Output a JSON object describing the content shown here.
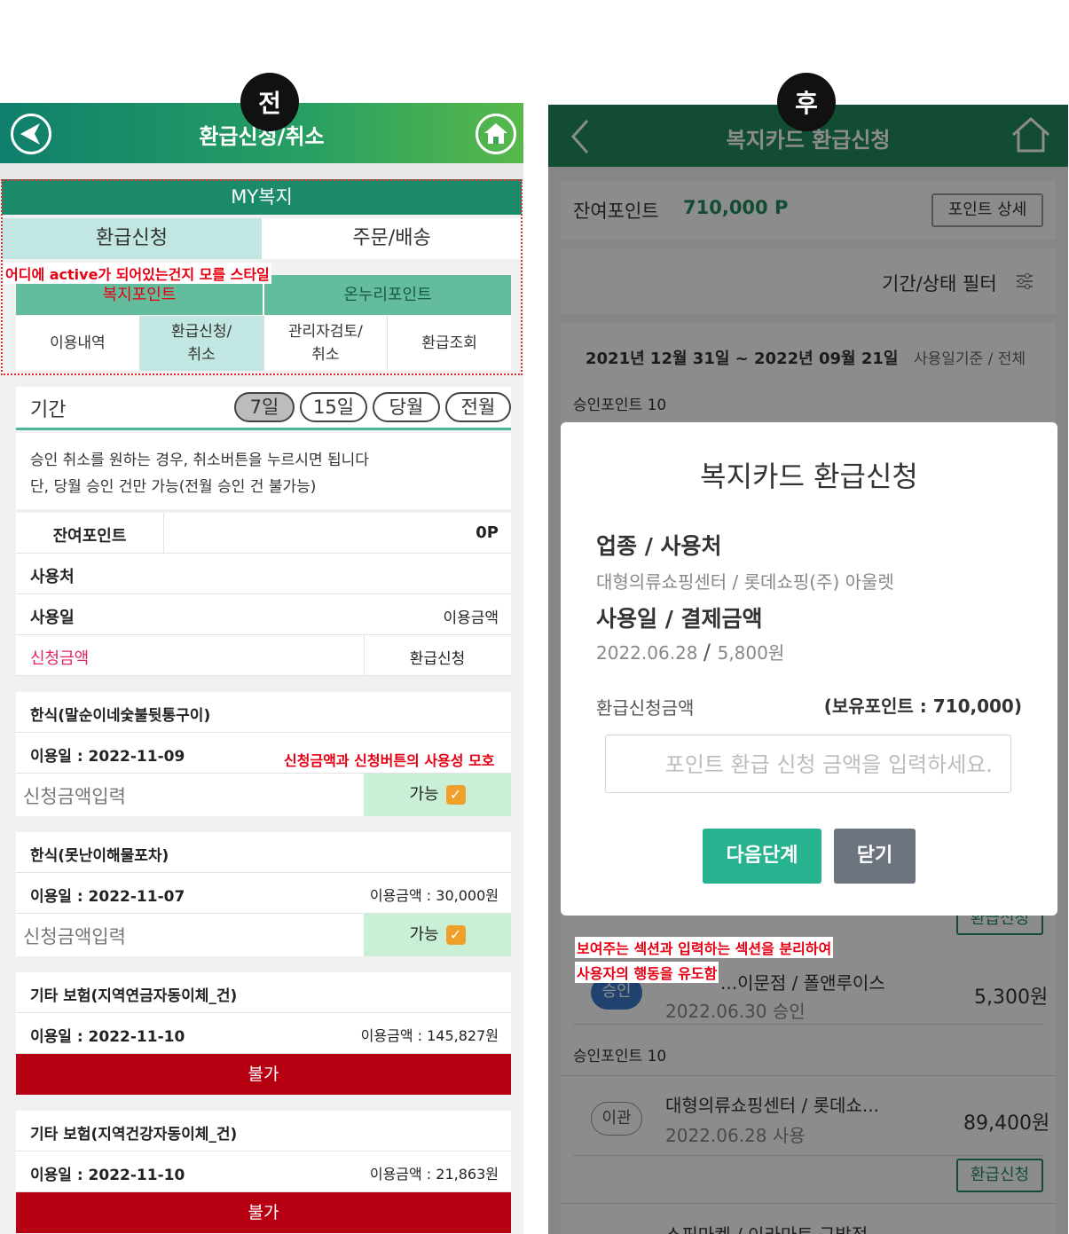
{
  "badges": {
    "before": "전",
    "after": "후"
  },
  "left": {
    "header_title": "환급신청/취소",
    "myw": "MY복지",
    "tabs1": [
      "환급신청",
      "주문/배송"
    ],
    "note_active": "어디에 active가 되어있는건지 모를 스타일",
    "tabs2": [
      "복지포인트",
      "온누리포인트"
    ],
    "tabs3": [
      "이용내역",
      "환급신청/\n취소",
      "관리자검토/\n취소",
      "환급조회"
    ],
    "period": {
      "label": "기간",
      "pills": [
        "7일",
        "15일",
        "당월",
        "전월"
      ]
    },
    "info_lines": [
      "승인 취소를 원하는 경우, 취소버튼을 누르시면 됩니다",
      "단, 당월 승인 건만 가능(전월 승인 건 불가능)"
    ],
    "summary": {
      "balance_label": "잔여포인트",
      "balance_value": "0P",
      "usage_place": "사용처",
      "usage_date": "사용일",
      "usage_amount": "이용금액",
      "request_amount": "신청금액",
      "request_btn": "환급신청"
    },
    "note_usability": "신청금액과 신청버튼의 사용성 모호",
    "items": [
      {
        "title": "한식(말순이네숯불뒷통구이)",
        "date": "이용일 : 2022-11-09",
        "amount": "",
        "input": "신청금액입력",
        "status": "가능"
      },
      {
        "title": "한식(못난이해물포차)",
        "date": "이용일 : 2022-11-07",
        "amount": "이용금액 : 30,000원",
        "input": "신청금액입력",
        "status": "가능"
      },
      {
        "title": "기타 보험(지역연금자동이체_건)",
        "date": "이용일 : 2022-11-10",
        "amount": "이용금액 : 145,827원",
        "status": "불가"
      },
      {
        "title": "기타 보험(지역건강자동이체_건)",
        "date": "이용일 : 2022-11-10",
        "amount": "이용금액 : 21,863원",
        "status": "불가"
      }
    ]
  },
  "right": {
    "header_title": "복지카드 환급신청",
    "balance_label": "잔여포인트",
    "balance_value": "710,000 P",
    "detail_btn": "포인트 상세",
    "filter": "기간/상태 필터",
    "date_range": "2021년 12월 31일 ~ 2022년 09월 21일",
    "date_basis": "사용일기준 / 전체",
    "peek_text": "승인포인트  10",
    "list": [
      {
        "chip": "승인",
        "chip_color": "#3a78c9",
        "title": "화브...피프이문점 / 폴앤루이스",
        "title_visible": "...이문점 / 폴앤루이스",
        "date": "2022.06.30 승인",
        "amount": "5,300원",
        "points": "승인포인트  10"
      },
      {
        "chip": "이관",
        "title": "대형의류쇼핑센터 / 롯데쇼...",
        "date": "2022.06.28 사용",
        "amount": "89,400원",
        "btn": "환급신청"
      }
    ],
    "peek_btn": "환급신청",
    "bottom_peek": "쇼핑마켓 / 이라마트 구발점",
    "modal": {
      "title": "복지카드 환급신청",
      "type_label": "업종 / 사용처",
      "type_value": "대형의류쇼핑센터 / 롯데쇼핑(주) 아울렛",
      "date_label": "사용일 / 결제금액",
      "date_value": "2022.06.28",
      "amount_value": "5,800원",
      "req_label": "환급신청금액",
      "hold_points": "(보유포인트 : 710,000)",
      "placeholder": "포인트 환급 신청 금액을 입력하세요.",
      "next_btn": "다음단계",
      "close_btn": "닫기"
    },
    "note_lines": [
      "보여주는 섹션과 입력하는 섹션을 분리하여",
      "사용자의 행동을 유도함"
    ]
  },
  "colors": {
    "left_green": "#1b8a6b",
    "right_green": "#1f8a5e",
    "danger": "#b60012",
    "mint": "#27b38f",
    "slate": "#6c757d"
  }
}
